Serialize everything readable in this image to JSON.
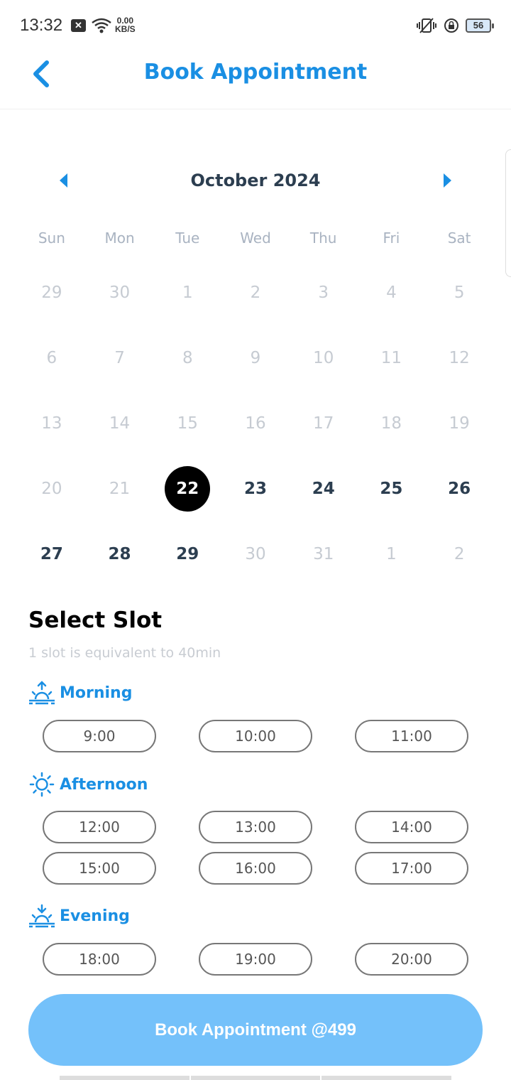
{
  "status_bar": {
    "time": "13:32",
    "net_speed_value": "0.00",
    "net_speed_unit": "KB/S",
    "battery": "56",
    "icons": [
      "close-notification-icon",
      "wifi-icon",
      "vibrate-icon",
      "rotation-lock-icon",
      "battery-icon"
    ]
  },
  "header": {
    "title": "Book Appointment",
    "back_icon": "chevron-left-icon"
  },
  "calendar": {
    "month_label": "October 2024",
    "weekdays": [
      "Sun",
      "Mon",
      "Tue",
      "Wed",
      "Thu",
      "Fri",
      "Sat"
    ],
    "days": [
      {
        "label": "29",
        "state": "disabled"
      },
      {
        "label": "30",
        "state": "disabled"
      },
      {
        "label": "1",
        "state": "disabled"
      },
      {
        "label": "2",
        "state": "disabled"
      },
      {
        "label": "3",
        "state": "disabled"
      },
      {
        "label": "4",
        "state": "disabled"
      },
      {
        "label": "5",
        "state": "disabled"
      },
      {
        "label": "6",
        "state": "disabled"
      },
      {
        "label": "7",
        "state": "disabled"
      },
      {
        "label": "8",
        "state": "disabled"
      },
      {
        "label": "9",
        "state": "disabled"
      },
      {
        "label": "10",
        "state": "disabled"
      },
      {
        "label": "11",
        "state": "disabled"
      },
      {
        "label": "12",
        "state": "disabled"
      },
      {
        "label": "13",
        "state": "disabled"
      },
      {
        "label": "14",
        "state": "disabled"
      },
      {
        "label": "15",
        "state": "disabled"
      },
      {
        "label": "16",
        "state": "disabled"
      },
      {
        "label": "17",
        "state": "disabled"
      },
      {
        "label": "18",
        "state": "disabled"
      },
      {
        "label": "19",
        "state": "disabled"
      },
      {
        "label": "20",
        "state": "disabled"
      },
      {
        "label": "21",
        "state": "disabled"
      },
      {
        "label": "22",
        "state": "selected"
      },
      {
        "label": "23",
        "state": "active"
      },
      {
        "label": "24",
        "state": "active"
      },
      {
        "label": "25",
        "state": "active"
      },
      {
        "label": "26",
        "state": "active"
      },
      {
        "label": "27",
        "state": "active"
      },
      {
        "label": "28",
        "state": "active"
      },
      {
        "label": "29",
        "state": "active"
      },
      {
        "label": "30",
        "state": "disabled"
      },
      {
        "label": "31",
        "state": "disabled"
      },
      {
        "label": "1",
        "state": "disabled"
      },
      {
        "label": "2",
        "state": "disabled"
      }
    ]
  },
  "slots": {
    "title": "Select Slot",
    "subtitle": "1 slot is equivalent to 40min",
    "morning": {
      "label": "Morning",
      "icon": "sunrise-icon",
      "times": [
        "9:00",
        "10:00",
        "11:00"
      ]
    },
    "afternoon": {
      "label": "Afternoon",
      "icon": "sun-icon",
      "times": [
        "12:00",
        "13:00",
        "14:00",
        "15:00",
        "16:00",
        "17:00"
      ]
    },
    "evening": {
      "label": "Evening",
      "icon": "sunset-icon",
      "times": [
        "18:00",
        "19:00",
        "20:00"
      ]
    }
  },
  "book_button": {
    "label": "Book Appointment @499"
  },
  "colors": {
    "accent": "#1a8fe3",
    "button": "#74c1fa",
    "selected_day": "#000000"
  }
}
